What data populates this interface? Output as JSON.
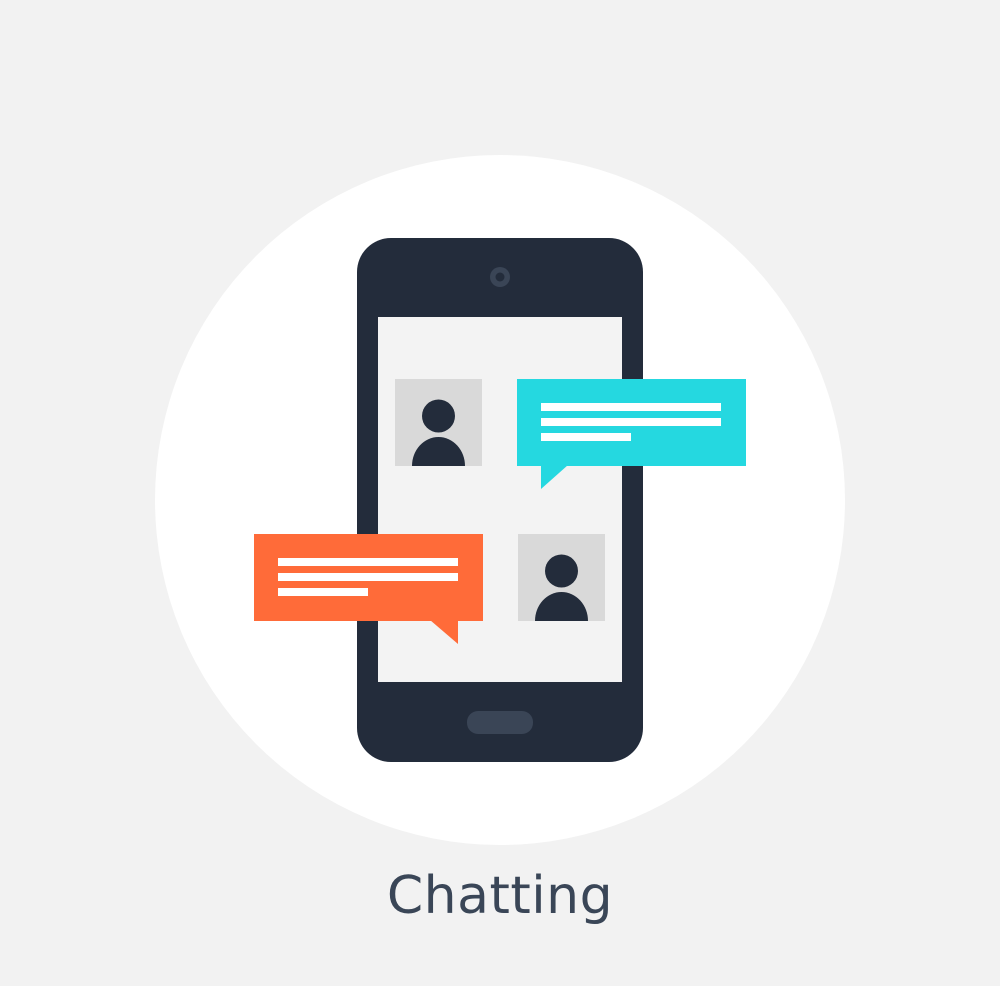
{
  "caption": "Chatting",
  "icons": {
    "phone": "smartphone-icon",
    "avatar_top": "user-avatar-icon",
    "avatar_bottom": "user-avatar-icon",
    "bubble_blue": "chat-bubble-icon",
    "bubble_orange": "chat-bubble-icon"
  },
  "colors": {
    "background": "#f2f2f2",
    "circle": "#ffffff",
    "phone_body": "#232c3b",
    "phone_screen": "#f3f3f3",
    "avatar_tile": "#d9d9d9",
    "bubble_blue": "#25d8e0",
    "bubble_orange": "#ff6b39",
    "text_lines": "#ffffff",
    "caption_text": "#3a4657"
  }
}
